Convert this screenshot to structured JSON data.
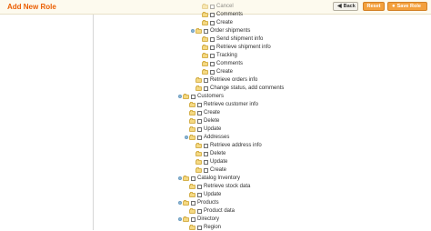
{
  "header": {
    "title": "Add New Role",
    "back_label": "Back",
    "reset_label": "Reset",
    "save_label": "Save Role"
  },
  "tree": {
    "items": [
      {
        "label": "Cancel",
        "depth": 3,
        "expander": false
      },
      {
        "label": "Comments",
        "depth": 3,
        "expander": false
      },
      {
        "label": "Create",
        "depth": 3,
        "expander": false
      },
      {
        "label": "Order shipments",
        "depth": 2,
        "expander": true
      },
      {
        "label": "Send shipment info",
        "depth": 3,
        "expander": false
      },
      {
        "label": "Retrieve shipment info",
        "depth": 3,
        "expander": false
      },
      {
        "label": "Tracking",
        "depth": 3,
        "expander": false
      },
      {
        "label": "Comments",
        "depth": 3,
        "expander": false
      },
      {
        "label": "Create",
        "depth": 3,
        "expander": false
      },
      {
        "label": "Retrieve orders info",
        "depth": 2,
        "expander": false
      },
      {
        "label": "Change status, add comments",
        "depth": 2,
        "expander": false
      },
      {
        "label": "Customers",
        "depth": 0,
        "expander": true
      },
      {
        "label": "Retrieve customer info",
        "depth": 1,
        "expander": false
      },
      {
        "label": "Create",
        "depth": 1,
        "expander": false
      },
      {
        "label": "Delete",
        "depth": 1,
        "expander": false
      },
      {
        "label": "Update",
        "depth": 1,
        "expander": false
      },
      {
        "label": "Addresses",
        "depth": 1,
        "expander": true
      },
      {
        "label": "Retrieve address info",
        "depth": 2,
        "expander": false
      },
      {
        "label": "Delete",
        "depth": 2,
        "expander": false
      },
      {
        "label": "Update",
        "depth": 2,
        "expander": false
      },
      {
        "label": "Create",
        "depth": 2,
        "expander": false
      },
      {
        "label": "Catalog Inventory",
        "depth": 0,
        "expander": true
      },
      {
        "label": "Retrieve stock data",
        "depth": 1,
        "expander": false
      },
      {
        "label": "Update",
        "depth": 1,
        "expander": false
      },
      {
        "label": "Products",
        "depth": 0,
        "expander": true
      },
      {
        "label": "Product data",
        "depth": 1,
        "expander": false
      },
      {
        "label": "Directory",
        "depth": 0,
        "expander": true
      },
      {
        "label": "Region",
        "depth": 1,
        "expander": false
      }
    ]
  }
}
